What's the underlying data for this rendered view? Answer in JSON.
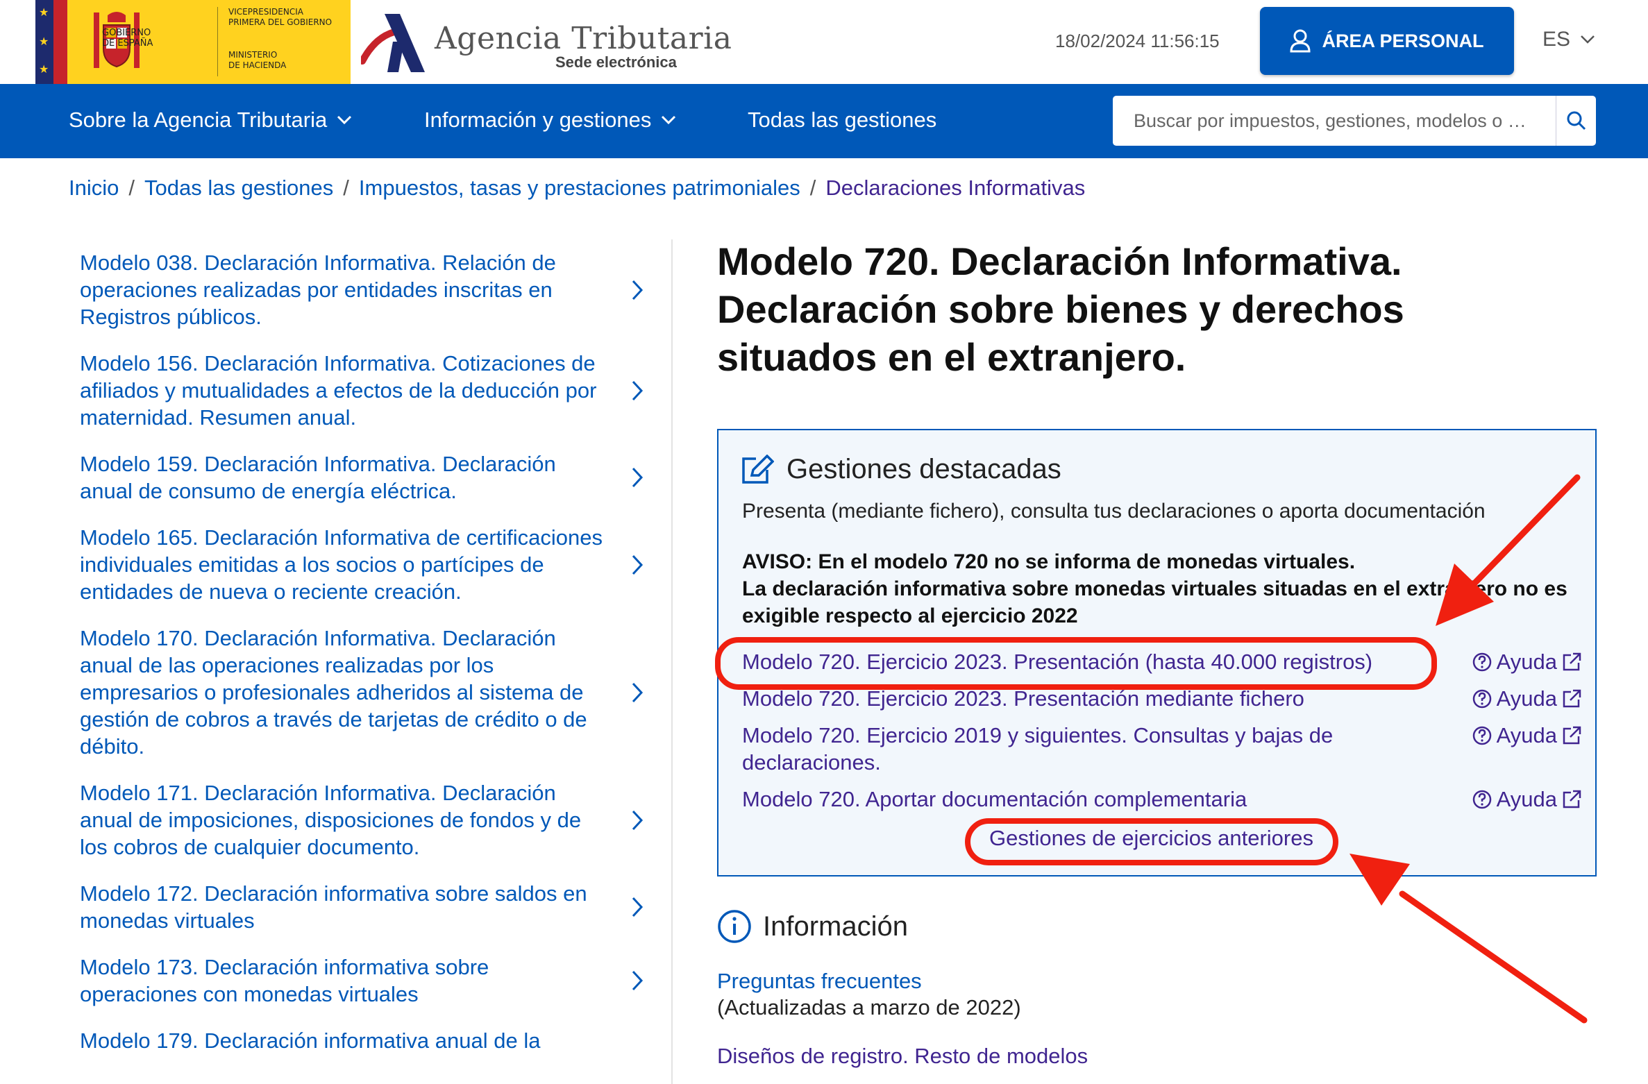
{
  "header": {
    "gov_line1": "Gobierno",
    "gov_line2": "de España",
    "vice_line1": "Vicepresidencia",
    "vice_line2": "Primera del Gobierno",
    "ministry_line1": "Ministerio",
    "ministry_line2": "de Hacienda",
    "site_name": "Agencia Tributaria",
    "site_subtitle": "Sede electrónica",
    "datetime": "18/02/2024 11:56:15",
    "area_personal_label": "ÁREA PERSONAL",
    "language": "ES"
  },
  "nav": {
    "items": [
      {
        "label": "Sobre la Agencia Tributaria"
      },
      {
        "label": "Información y gestiones"
      },
      {
        "label": "Todas las gestiones"
      }
    ],
    "search_placeholder": "Buscar por impuestos, gestiones, modelos o …"
  },
  "breadcrumb": {
    "items": [
      "Inicio",
      "Todas las gestiones",
      "Impuestos, tasas y prestaciones patrimoniales"
    ],
    "current": "Declaraciones Informativas"
  },
  "sidebar": {
    "items": [
      {
        "label": "Modelo 038. Declaración Informativa. Relación de operaciones realizadas por entidades inscritas en Registros públicos."
      },
      {
        "label": "Modelo 156. Declaración Informativa. Cotizaciones de afiliados y mutualidades a efectos de la deducción por maternidad. Resumen anual."
      },
      {
        "label": "Modelo 159. Declaración Informativa. Declaración anual de consumo de energía eléctrica."
      },
      {
        "label": "Modelo 165. Declaración Informativa de certificaciones individuales emitidas a los socios o partícipes de entidades de nueva o reciente creación."
      },
      {
        "label": "Modelo 170. Declaración Informativa. Declaración anual de las operaciones realizadas por los empresarios o profesionales adheridos al sistema de gestión de cobros a través de tarjetas de crédito o de débito."
      },
      {
        "label": "Modelo 171. Declaración Informativa. Declaración anual de imposiciones, disposiciones de fondos y de los cobros de cualquier documento."
      },
      {
        "label": "Modelo 172. Declaración informativa sobre saldos en monedas virtuales"
      },
      {
        "label": "Modelo 173. Declaración informativa sobre operaciones con monedas virtuales"
      },
      {
        "label": "Modelo 179. Declaración informativa anual de la"
      }
    ]
  },
  "main": {
    "title": "Modelo 720. Declaración Informativa. Declaración sobre bienes y derechos situados en el extranjero.",
    "gestiones": {
      "title": "Gestiones destacadas",
      "description": "Presenta (mediante fichero), consulta tus declaraciones o aporta documentación",
      "aviso_line1": "AVISO: En el modelo 720 no se informa de monedas virtuales.",
      "aviso_line2": "La declaración informativa sobre monedas virtuales situadas en el extranjero no es exigible respecto al ejercicio 2022",
      "links": [
        {
          "label": "Modelo 720. Ejercicio 2023. Presentación (hasta 40.000 registros)",
          "help": "Ayuda"
        },
        {
          "label": "Modelo 720. Ejercicio 2023. Presentación mediante fichero",
          "help": "Ayuda"
        },
        {
          "label": "Modelo 720. Ejercicio 2019 y siguientes. Consultas y bajas de declaraciones.",
          "help": "Ayuda"
        },
        {
          "label": "Modelo 720. Aportar documentación complementaria",
          "help": "Ayuda"
        }
      ],
      "previous_years": "Gestiones de ejercicios anteriores"
    },
    "informacion": {
      "title": "Información",
      "faq_link": "Preguntas frecuentes",
      "faq_note": "(Actualizadas a marzo de 2022)",
      "design_link": "Diseños de registro. Resto de modelos"
    }
  },
  "colors": {
    "brand_blue": "#0058b8",
    "visited_link": "#402590",
    "annotation_red": "#f02010",
    "gov_yellow": "#ffd21f"
  }
}
